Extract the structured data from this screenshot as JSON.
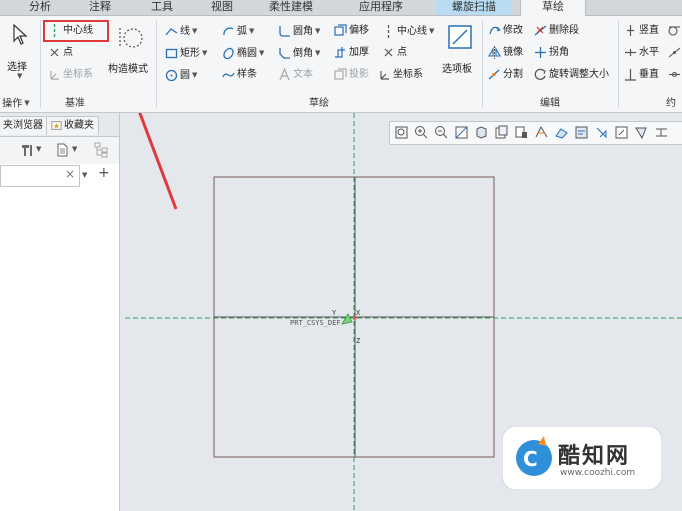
{
  "tabs": [
    {
      "label": "分析"
    },
    {
      "label": "注释"
    },
    {
      "label": "工具"
    },
    {
      "label": "视图"
    },
    {
      "label": "柔性建模"
    },
    {
      "label": "应用程序"
    },
    {
      "label": "螺旋扫描"
    },
    {
      "label": "草绘"
    }
  ],
  "ribbon": {
    "select_label": "选择",
    "operations_group": "操作",
    "datum": {
      "group": "基准",
      "centerline": "中心线",
      "point": "点",
      "coord": "坐标系"
    },
    "construction_mode": "构造模式",
    "sketch": {
      "group": "草绘",
      "line": "线",
      "arc": "弧",
      "fillet": "圆角",
      "offset": "偏移",
      "centerline": "中心线",
      "rect": "矩形",
      "ellipse": "椭圆",
      "chamfer": "倒角",
      "thicken": "加厚",
      "point": "点",
      "circle": "圆",
      "spline": "样条",
      "text": "文本",
      "project": "投影",
      "coord": "坐标系",
      "palette": "选项板"
    },
    "edit": {
      "group": "编辑",
      "modify": "修改",
      "delete_segment": "删除段",
      "mirror": "镜像",
      "corner": "拐角",
      "divide": "分割",
      "rotate_resize": "旋转调整大小"
    },
    "constrain": {
      "group": "约",
      "vertical": "竖直",
      "horizontal": "水平",
      "perpendicular": "垂直"
    }
  },
  "left_panel": {
    "tab_browser": "夹浏览器",
    "tab_favorites": "收藏夹"
  },
  "canvas": {
    "csys_label": "PRT_CSYS_DEF",
    "axis_x": "X",
    "axis_y": "Y",
    "axis_z": "Z"
  },
  "watermark": {
    "name": "酷知网",
    "url": "www.coozhi.com"
  },
  "colors": {
    "accent_tab": "#b9dcf2",
    "callout": "#e0393b",
    "centerline": "#2aa55a"
  }
}
